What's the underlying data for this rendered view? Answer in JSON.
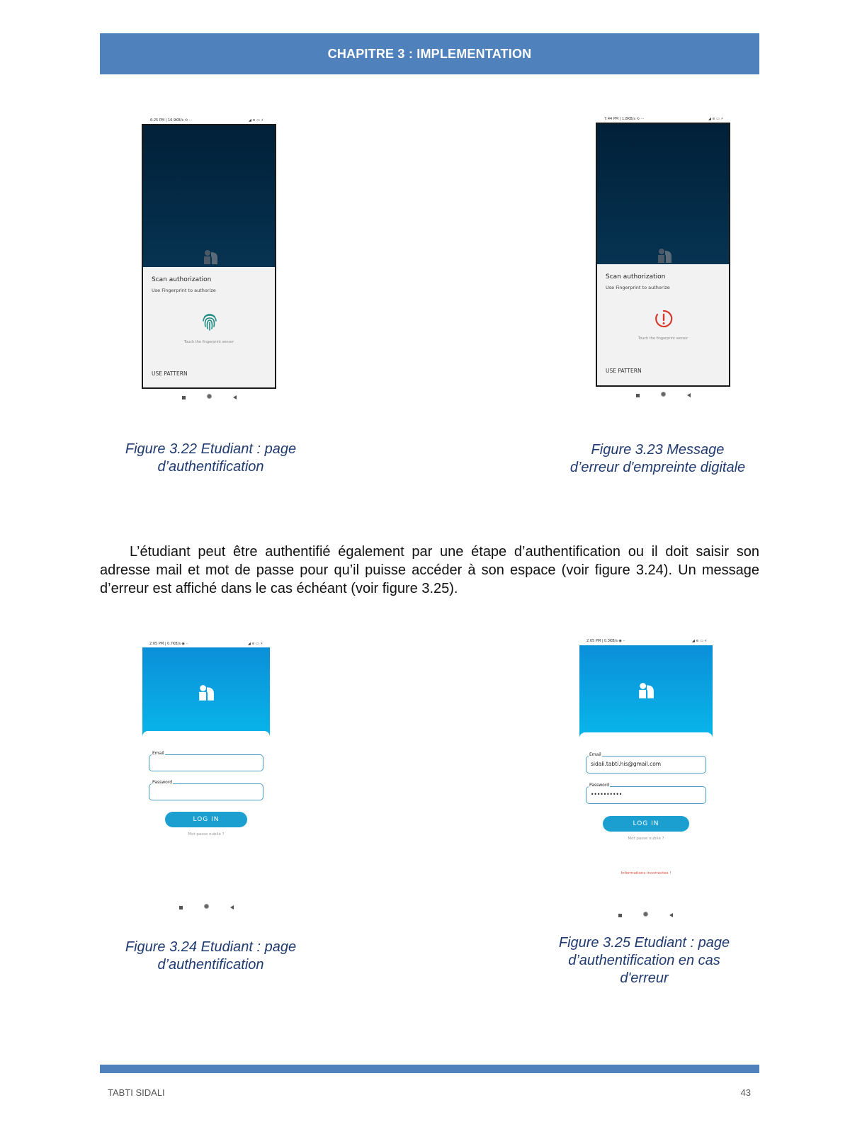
{
  "header": {
    "title": "CHAPITRE 3 : IMPLEMENTATION"
  },
  "phone1": {
    "status_left": "6:25 PM | 16.9KB/s ⟲ ···",
    "status_right": "◢ ≋ ▭ ⚡",
    "dialog_title": "Scan authorization",
    "dialog_subtitle": "Use Fingerprint to authorize",
    "hint": "Touch the fingerprint sensor",
    "alt_action": "USE PATTERN"
  },
  "phone2": {
    "status_left": "7:44 PM | 1.8KB/s ⟲ ···",
    "status_right": "◢ ≋ ▭ ⚡",
    "dialog_title": "Scan authorization",
    "dialog_subtitle": "Use Fingerprint to authorize",
    "hint": "Touch the fingerprint sensor",
    "alt_action": "USE PATTERN"
  },
  "captions": {
    "fig322_line1": "Figure 3.22 Etudiant : page",
    "fig322_line2": "d’authentification",
    "fig323_line1": "Figure 3.23 Message",
    "fig323_line2": "d’erreur d'empreinte digitale",
    "fig324_line1": "Figure 3.24 Etudiant : page",
    "fig324_line2": "d’authentification",
    "fig325_line1": "Figure 3.25 Etudiant : page",
    "fig325_line2": "d’authentification en cas",
    "fig325_line3": "d'erreur"
  },
  "paragraph": "L’étudiant peut être authentifié également par une étape d’authentification ou il doit saisir son adresse mail et mot de passe pour qu’il puisse accéder à son espace (voir figure 3.24). Un message d’erreur est affiché dans le cas échéant (voir figure 3.25).",
  "phone3": {
    "status_left": "2:05 PM | 0.7KB/s ◉ ··",
    "status_right": "◢ ≋ ▭ ⚡",
    "email_label": "Email",
    "password_label": "Password",
    "email_value": "",
    "password_value": "",
    "button": "LOG IN",
    "forgot": "Mot passe oublié ?"
  },
  "phone4": {
    "status_left": "2:05 PM | 0.3KB/s ◉ ··",
    "status_right": "◢ ≋ ▭ ⚡",
    "email_label": "Email",
    "password_label": "Password",
    "email_value": "sidali.tabti.his@gmail.com",
    "password_value": "••••••••••",
    "button": "LOG IN",
    "forgot": "Mot passe oublié ?",
    "error": "Informations incorrectes !"
  },
  "colors": {
    "accent": "#4f81bd",
    "caption": "#1f3a70",
    "error": "#e05040",
    "button": "#1a9fd0"
  },
  "footer": {
    "author": "TABTI SIDALI",
    "page": "43"
  }
}
